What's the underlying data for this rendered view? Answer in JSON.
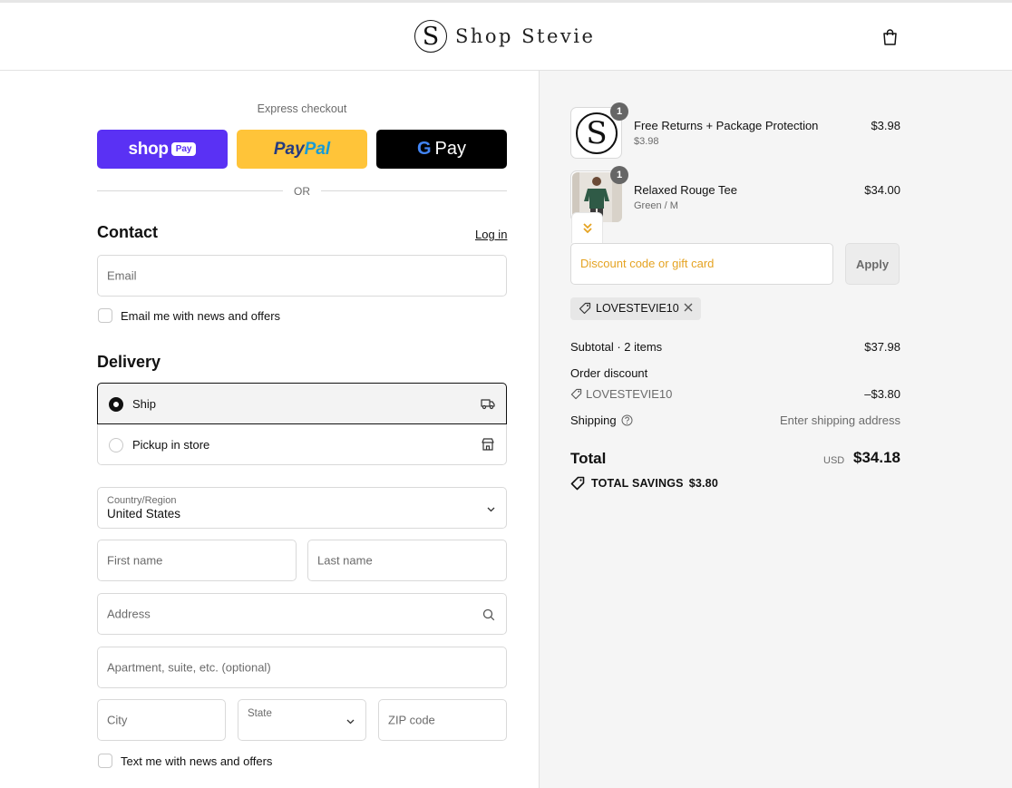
{
  "header": {
    "logo_mark": "S",
    "logo_text": "Shop Stevie",
    "cart_icon": "shopping-bag-icon"
  },
  "express": {
    "title": "Express checkout",
    "shoppay_text": "shop",
    "shoppay_pill": "Pay",
    "paypal_1": "Pay",
    "paypal_2": "Pal",
    "gpay_g": "G",
    "gpay_text": "Pay",
    "or": "OR"
  },
  "contact": {
    "heading": "Contact",
    "login": "Log in",
    "email_placeholder": "Email",
    "newsletter_label": "Email me with news and offers"
  },
  "delivery": {
    "heading": "Delivery",
    "options": [
      {
        "label": "Ship",
        "selected": true,
        "icon": "truck-icon"
      },
      {
        "label": "Pickup in store",
        "selected": false,
        "icon": "store-icon"
      }
    ],
    "country_label": "Country/Region",
    "country_value": "United States",
    "first_name": "First name",
    "last_name": "Last name",
    "address": "Address",
    "apartment": "Apartment, suite, etc. (optional)",
    "city": "City",
    "state": "State",
    "zip": "ZIP code",
    "sms_label": "Text me with news and offers"
  },
  "order": {
    "items": [
      {
        "name": "Free Returns + Package Protection",
        "sub": "$3.98",
        "price": "$3.98",
        "qty": "1"
      },
      {
        "name": "Relaxed Rouge Tee",
        "sub": "Green / M",
        "price": "$34.00",
        "qty": "1"
      }
    ],
    "discount_placeholder": "Discount code or gift card",
    "apply": "Apply",
    "applied_code": "LOVESTEVIE10",
    "subtotal_label": "Subtotal · 2 items",
    "subtotal_value": "$37.98",
    "order_discount_label": "Order discount",
    "discount_code": "LOVESTEVIE10",
    "discount_value": "–$3.80",
    "shipping_label": "Shipping",
    "shipping_value": "Enter shipping address",
    "total_label": "Total",
    "currency": "USD",
    "total_value": "$34.18",
    "savings_label": "TOTAL SAVINGS",
    "savings_value": "$3.80"
  },
  "colors": {
    "shoppay": "#5a31f4",
    "paypal": "#ffc439",
    "gpay": "#000000",
    "discount_placeholder": "#e5a322",
    "sidebar_bg": "#f5f5f5"
  }
}
